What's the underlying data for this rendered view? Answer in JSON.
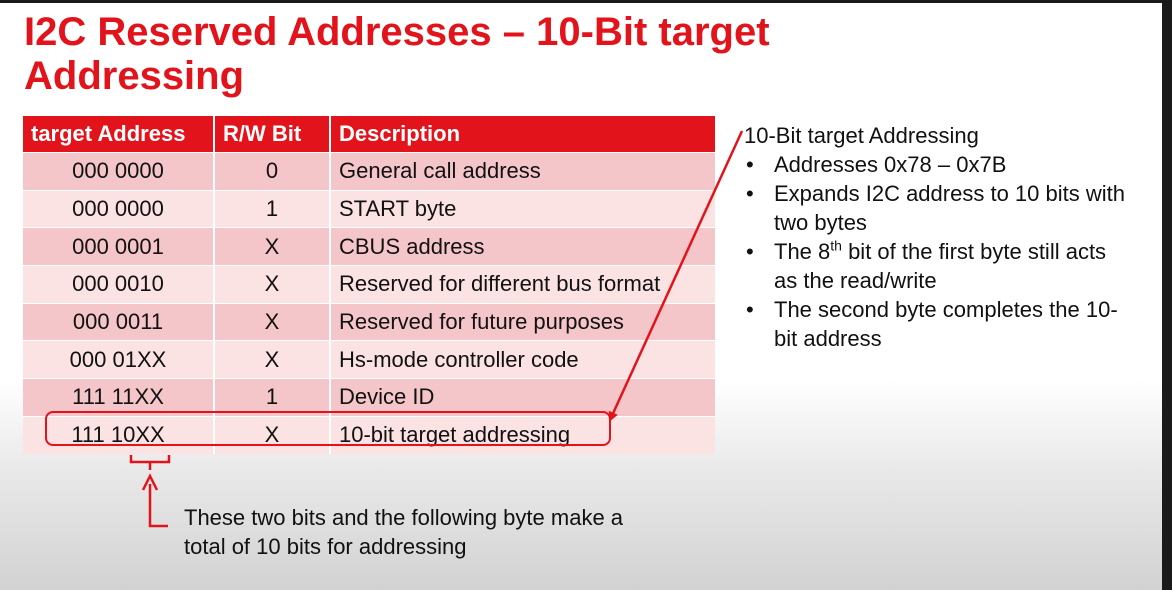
{
  "title": "I2C Reserved Addresses – 10-Bit target Addressing",
  "table": {
    "headers": [
      "target Address",
      "R/W Bit",
      "Description"
    ],
    "rows": [
      [
        "000 0000",
        "0",
        "General call address"
      ],
      [
        "000 0000",
        "1",
        "START byte"
      ],
      [
        "000 0001",
        "X",
        "CBUS address"
      ],
      [
        "000 0010",
        "X",
        "Reserved for different bus format"
      ],
      [
        "000 0011",
        "X",
        "Reserved for future purposes"
      ],
      [
        "000 01XX",
        "X",
        "Hs-mode controller code"
      ],
      [
        "111 11XX",
        "1",
        "Device ID"
      ],
      [
        "111 10XX",
        "X",
        "10-bit target addressing"
      ]
    ],
    "highlighted_row": 7
  },
  "panel": {
    "heading": "10-Bit target Addressing",
    "bullet1": "Addresses 0x78 – 0x7B",
    "bullet2": "Expands I2C address to 10 bits with two bytes",
    "bullet3_pre": "The 8",
    "bullet3_sup": "th",
    "bullet3_post": " bit of the first byte still acts as the read/write",
    "bullet4": "The second byte completes the 10-bit address"
  },
  "note": "These two bits and the following byte make a total of 10 bits for addressing",
  "colors": {
    "accent": "#e3131b",
    "row_dark": "#f5c6c9",
    "row_light": "#fbe2e3"
  }
}
